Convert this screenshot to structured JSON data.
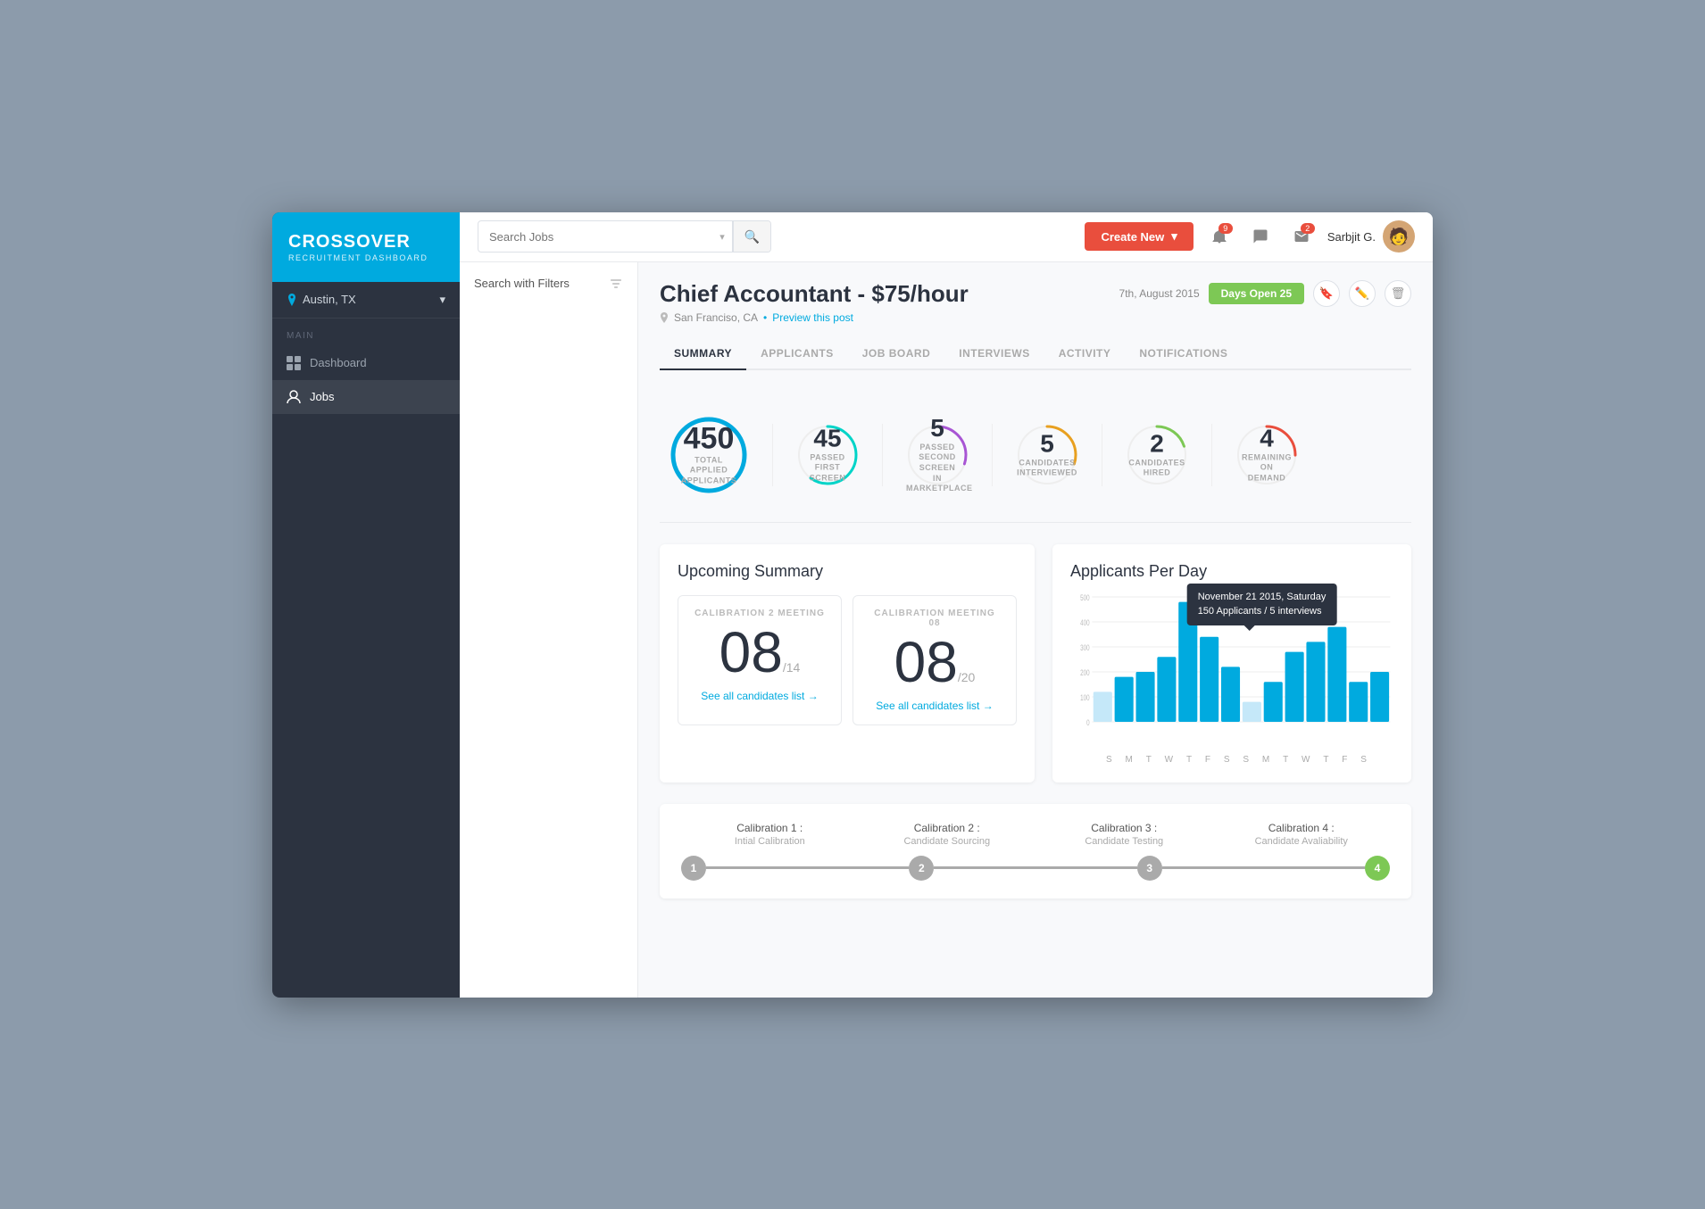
{
  "sidebar": {
    "logo_title": "CROSSOVER",
    "logo_sub": "RECRUITMENT DASHBOARD",
    "location": "Austin, TX",
    "section_label": "MAIN",
    "nav_items": [
      {
        "id": "dashboard",
        "label": "Dashboard",
        "active": false
      },
      {
        "id": "jobs",
        "label": "Jobs",
        "active": true
      }
    ]
  },
  "topbar": {
    "search_placeholder": "Search Jobs",
    "create_new_label": "Create New",
    "notification_count": "9",
    "message_count": "",
    "email_count": "2",
    "user_name": "Sarbjit G."
  },
  "filter": {
    "label": "Search with Filters"
  },
  "job": {
    "title": "Chief Accountant - $75/hour",
    "location": "San Franciso, CA",
    "preview_link": "Preview this post",
    "date": "7th, August 2015",
    "days_open": "Days Open 25"
  },
  "tabs": [
    {
      "id": "summary",
      "label": "SUMMARY",
      "active": true
    },
    {
      "id": "applicants",
      "label": "APPLICANTS",
      "active": false
    },
    {
      "id": "job_board",
      "label": "JOB BOARD",
      "active": false
    },
    {
      "id": "interviews",
      "label": "INTERVIEWS",
      "active": false
    },
    {
      "id": "activity",
      "label": "ACTIVITY",
      "active": false
    },
    {
      "id": "notifications",
      "label": "NOTIFICATIONS",
      "active": false
    }
  ],
  "stats": [
    {
      "id": "total_applied",
      "number": "450",
      "label": "TOTAL APPLIED\nAPPLICANTS",
      "color": "#00aadf",
      "pct": 100,
      "size": "large"
    },
    {
      "id": "passed_first",
      "number": "45",
      "label": "PASSED FIRST\nSCREEN",
      "color": "#00d4c8",
      "pct": 60
    },
    {
      "id": "passed_second",
      "number": "5",
      "label": "PASSED SECOND\nSCREEN\nIN MARKETPLACE",
      "color": "#a855d4",
      "pct": 30
    },
    {
      "id": "candidates_interviewed",
      "number": "5",
      "label": "CANDIDATES\nINTERVIEWED",
      "color": "#e8a020",
      "pct": 30
    },
    {
      "id": "candidates_hired",
      "number": "2",
      "label": "CANDIDATES\nHIRED",
      "color": "#7dc855",
      "pct": 20
    },
    {
      "id": "remaining_demand",
      "number": "4",
      "label": "REMAINING\nON DEMAND",
      "color": "#e94e3d",
      "pct": 25
    }
  ],
  "upcoming": {
    "title": "Upcoming Summary",
    "cards": [
      {
        "id": "cal2",
        "title": "CALIBRATION 2 MEETING",
        "big_num": "08",
        "sub": "/14",
        "link": "See all candidates list →"
      },
      {
        "id": "cal3",
        "title": "CALIBRATION MEETING 08",
        "big_num": "08",
        "sub": "/20",
        "link": "See all candidates list →"
      }
    ]
  },
  "chart": {
    "title": "Applicants Per Day",
    "tooltip_line1": "November 21 2015, Saturday",
    "tooltip_line2": "150 Applicants / 5 interviews",
    "y_labels": [
      "500",
      "400",
      "300",
      "200",
      "100",
      "0"
    ],
    "x_labels": [
      "S",
      "M",
      "T",
      "W",
      "T",
      "F",
      "S",
      "S",
      "M",
      "T",
      "W",
      "T",
      "F",
      "S"
    ],
    "bars": [
      120,
      180,
      200,
      260,
      480,
      340,
      220,
      80,
      160,
      280,
      320,
      380,
      160,
      200
    ]
  },
  "calibration_steps": [
    {
      "num": "1",
      "title": "Calibration 1 :",
      "sub": "Intial Calibration",
      "active": false
    },
    {
      "num": "2",
      "title": "Calibration 2 :",
      "sub": "Candidate Sourcing",
      "active": false
    },
    {
      "num": "3",
      "title": "Calibration 3 :",
      "sub": "Candidate Testing",
      "active": false
    },
    {
      "num": "4",
      "title": "Calibration 4 :",
      "sub": "Candidate Avaliability",
      "active": true
    }
  ]
}
